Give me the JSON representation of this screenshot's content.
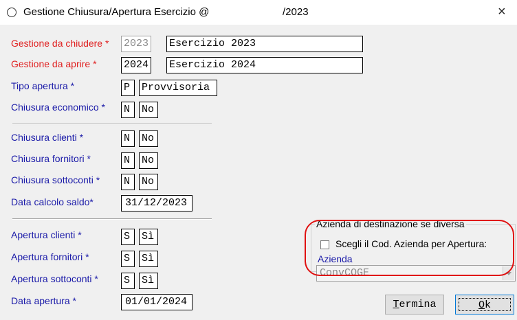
{
  "window": {
    "title": "Gestione Chiusura/Apertura Esercizio @",
    "title_year": "/2023",
    "close_glyph": "×",
    "title_icon": "circle-icon"
  },
  "fields": {
    "gestione_chiudere": {
      "label": "Gestione da chiudere *",
      "code": "2023",
      "desc": "Esercizio 2023"
    },
    "gestione_aprire": {
      "label": "Gestione da aprire *",
      "code": "2024",
      "desc": "Esercizio 2024"
    },
    "tipo_apertura": {
      "label": "Tipo apertura *",
      "code": "P",
      "desc": "Provvisoria"
    },
    "chiusura_economico": {
      "label": "Chiusura economico *",
      "code": "N",
      "desc": "No"
    },
    "chiusura_clienti": {
      "label": "Chiusura clienti *",
      "code": "N",
      "desc": "No"
    },
    "chiusura_fornitori": {
      "label": "Chiusura fornitori *",
      "code": "N",
      "desc": "No"
    },
    "chiusura_sottoconti": {
      "label": "Chiusura sottoconti *",
      "code": "N",
      "desc": "No"
    },
    "data_calcolo_saldo": {
      "label": "Data calcolo saldo*",
      "value": "31/12/2023"
    },
    "apertura_clienti": {
      "label": "Apertura clienti *",
      "code": "S",
      "desc": "Sì"
    },
    "apertura_fornitori": {
      "label": "Apertura fornitori *",
      "code": "S",
      "desc": "Sì"
    },
    "apertura_sottoconti": {
      "label": "Apertura sottoconti *",
      "code": "S",
      "desc": "Sì"
    },
    "data_apertura": {
      "label": "Data apertura *",
      "value": "01/01/2024"
    }
  },
  "destination_group": {
    "title": "Azienda di destinazione se diversa",
    "checkbox_label": "Scegli il Cod. Azienda per Apertura:",
    "checkbox_checked": false,
    "azienda_label": "Azienda",
    "azienda_value": "ConvCOGE"
  },
  "buttons": {
    "termina_accel": "T",
    "termina_rest": "ermina",
    "ok_accel": "O",
    "ok_rest": "k"
  },
  "colors": {
    "required_label": "#e02020",
    "label": "#1a1aa8",
    "highlight_oval": "#e01010"
  }
}
